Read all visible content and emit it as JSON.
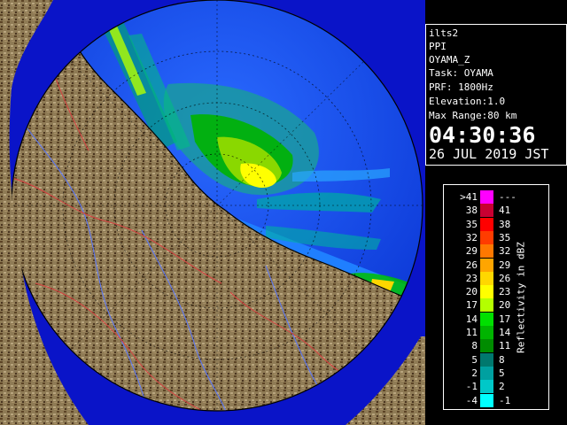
{
  "window": {
    "title": "ilts2"
  },
  "info": {
    "lines": [
      "ilts2",
      "PPI",
      "OYAMA_Z",
      "Task: OYAMA",
      "PRF: 1800Hz",
      "Elevation:1.0",
      "Max Range:80 km"
    ],
    "time": "04:30:36",
    "date": "26 JUL 2019 JST"
  },
  "legend": {
    "title": "Reflectivity in dBZ",
    "rows": [
      {
        "min": ">41",
        "max": "---",
        "color": "#ff00ff"
      },
      {
        "min": "38",
        "max": "41",
        "color": "#c80032"
      },
      {
        "min": "35",
        "max": "38",
        "color": "#ff0000"
      },
      {
        "min": "32",
        "max": "35",
        "color": "#ff3c00"
      },
      {
        "min": "29",
        "max": "32",
        "color": "#ff7800"
      },
      {
        "min": "26",
        "max": "29",
        "color": "#ffa500"
      },
      {
        "min": "23",
        "max": "26",
        "color": "#ffd700"
      },
      {
        "min": "20",
        "max": "23",
        "color": "#ffff00"
      },
      {
        "min": "17",
        "max": "20",
        "color": "#b4ff00"
      },
      {
        "min": "14",
        "max": "17",
        "color": "#00e000"
      },
      {
        "min": "11",
        "max": "14",
        "color": "#00b400"
      },
      {
        "min": "8",
        "max": "11",
        "color": "#008c00"
      },
      {
        "min": "5",
        "max": "8",
        "color": "#00786e"
      },
      {
        "min": "2",
        "max": "5",
        "color": "#00a0a0"
      },
      {
        "min": "-1",
        "max": "2",
        "color": "#00c8c8"
      },
      {
        "min": "-4",
        "max": "-1",
        "color": "#00ffff"
      }
    ]
  },
  "colors": {
    "sea": "#0a14c8",
    "sea_echo": "#1a73ff",
    "land": "#8a7550",
    "range_ring": "#000000"
  }
}
